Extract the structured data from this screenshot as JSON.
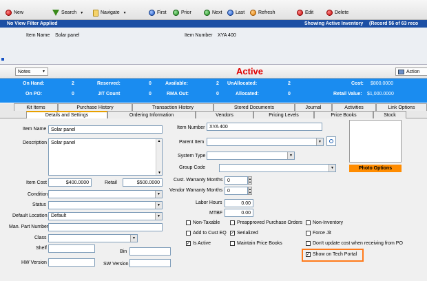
{
  "toolbar": {
    "new": "New",
    "search": "Search",
    "navigate": "Navigate",
    "first": "First",
    "prior": "Prior",
    "next": "Next",
    "last": "Last",
    "refresh": "Refresh",
    "edit": "Edit",
    "delete": "Delete"
  },
  "filterbar": {
    "left": "No View Filter Applied",
    "middle": "Showing Active Inventory",
    "right": "(Record 56 of 63 reco"
  },
  "header": {
    "item_name_label": "Item Name",
    "item_name_value": "Solar panel",
    "item_number_label": "Item Number",
    "item_number_value": "XYA 400"
  },
  "notesbar": {
    "notes": "Notes",
    "status": "Active",
    "action": "Action"
  },
  "summary": {
    "on_hand_label": "On Hand:",
    "on_hand_value": "2",
    "reserved_label": "Reserved:",
    "reserved_value": "0",
    "available_label": "Available:",
    "available_value": "2",
    "unallocated_label": "UnAllocated:",
    "unallocated_value": "2",
    "cost_label": "Cost:",
    "cost_value": "$800.0000",
    "on_po_label": "On PO:",
    "on_po_value": "0",
    "jit_label": "JIT Count",
    "jit_value": "0",
    "rma_label": "RMA Out:",
    "rma_value": "0",
    "allocated_label": "Allocated:",
    "allocated_value": "0",
    "retail_label": "Retail Value:",
    "retail_value": "$1,000.0000"
  },
  "tabs_row1": [
    "Kit Items",
    "Purchase History",
    "Transaction History",
    "Stored Documents",
    "Journal",
    "Activities",
    "Link Options"
  ],
  "tabs_row2": [
    "Details and Settings",
    "Ordering Information",
    "Vendors",
    "Pricing Levels",
    "Price Books",
    "Stock"
  ],
  "form": {
    "item_name_label": "Item Name",
    "item_name_value": "Solar panel",
    "description_label": "Description",
    "description_value": "Solar panel",
    "item_cost_label": "Item Cost",
    "item_cost_value": "$400.0000",
    "retail_label": "Retail",
    "retail_value": "$500.0000",
    "condition_label": "Condition",
    "status_label": "Status",
    "default_location_label": "Default Location",
    "default_location_value": "Default",
    "man_part_label": "Man. Part Number",
    "class_label": "Class",
    "shelf_label": "Shelf",
    "bin_label": "Bin",
    "hw_version_label": "HW Version",
    "sw_version_label": "SW Version",
    "item_number_label": "Item Number",
    "item_number_value": "XYA 400",
    "parent_item_label": "Parent Item",
    "system_type_label": "System Type",
    "group_code_label": "Group Code",
    "cust_warranty_label": "Cust. Warranty Months",
    "cust_warranty_value": "0",
    "vendor_warranty_label": "Vendor Warranty Months",
    "vendor_warranty_value": "0",
    "labor_hours_label": "Labor Hours",
    "labor_hours_value": "0.00",
    "mtbf_label": "MTBF",
    "mtbf_value": "0.00",
    "photo_options": "Photo Options"
  },
  "checks": {
    "non_taxable": "Non-Taxable",
    "preapproved": "Preapproved Purchase Orders",
    "non_inventory": "Non-Inventory",
    "add_to_cust_eq": "Add to Cust EQ",
    "serialized": "Serialized",
    "force_jit": "Force Jit",
    "is_active": "Is Active",
    "maintain_price_books": "Maintain Price Books",
    "dont_update_cost": "Don't update cost when receiving from PO",
    "show_on_tech_portal": "Show on Tech Portal"
  },
  "colors": {
    "filter_bar": "#1c4fa4",
    "summary_bar": "#1a8cf0",
    "status_active": "#e00000",
    "photo_button": "#ff8c00",
    "highlight": "#ff7a1a"
  }
}
